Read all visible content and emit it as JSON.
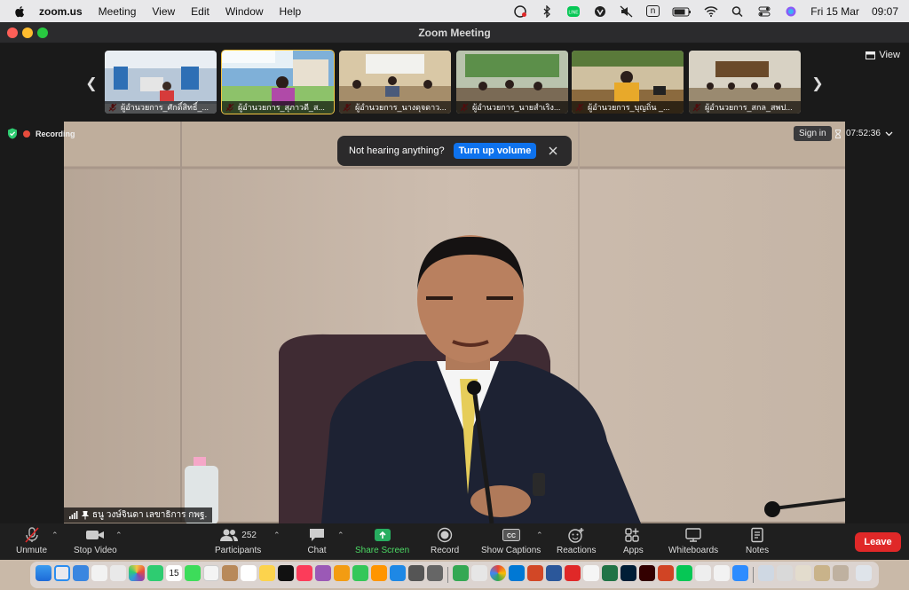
{
  "menubar": {
    "app_name": "zoom.us",
    "menus": [
      "Meeting",
      "View",
      "Edit",
      "Window",
      "Help"
    ],
    "date": "Fri 15 Mar",
    "time": "09:07",
    "input_source": "n"
  },
  "window": {
    "title": "Zoom Meeting"
  },
  "filmstrip": {
    "view_label": "View",
    "thumbnails": [
      {
        "name": "ผู้อำนวยการ_ศักดิ์สิทธิ์_...",
        "muted": true
      },
      {
        "name": "ผู้อำนวยการ_สุภาวดี_ส...",
        "muted": true
      },
      {
        "name": "ผู้อำนวยการ_นางดุจดาว...",
        "muted": true
      },
      {
        "name": "ผู้อำนวยการ_นายสำเริง...",
        "muted": true
      },
      {
        "name": "ผู้อำนวยการ_บุญถิ่น _...",
        "muted": true
      },
      {
        "name": "ผู้อำนวยการ_สกล_สพป...",
        "muted": true
      }
    ]
  },
  "meeting": {
    "recording_label": "Recording",
    "sign_in_label": "Sign in",
    "elapsed": "07:52:36",
    "toast_text": "Not hearing anything?",
    "toast_action": "Turn up volume",
    "speaker_name": "ธนู วงษ์จินดา เลขาธิการ กพฐ."
  },
  "toolbar": {
    "unmute": "Unmute",
    "stop_video": "Stop Video",
    "participants": "Participants",
    "participant_count": "252",
    "chat": "Chat",
    "share_screen": "Share Screen",
    "record": "Record",
    "show_captions": "Show Captions",
    "reactions": "Reactions",
    "apps": "Apps",
    "whiteboards": "Whiteboards",
    "notes": "Notes",
    "leave": "Leave"
  },
  "dock": {
    "calendar_day": "15"
  }
}
